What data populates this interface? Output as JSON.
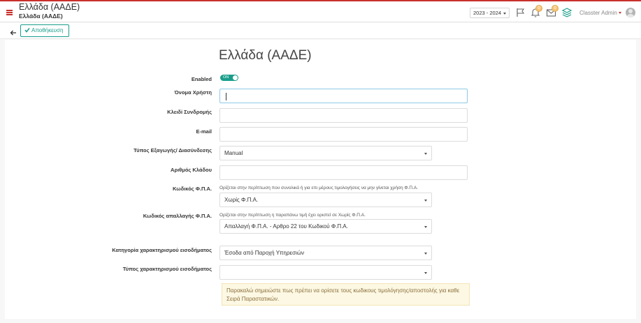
{
  "header": {
    "title": "Ελλάδα (ΑΑΔΕ)",
    "subtitle": "Ελλάδα (ΑΑΔΕ)",
    "year_select": "2023 - 2024",
    "alerts_count": "0",
    "messages_count": "0",
    "user_name": "Classter Admin"
  },
  "toolbar": {
    "save_label": "Αποθήκευση"
  },
  "form": {
    "title": "Ελλάδα (ΑΑΔΕ)",
    "enabled": {
      "label": "Enabled",
      "toggle_text": "ON",
      "value": true
    },
    "username": {
      "label": "Όνομα Χρήστη",
      "value": ""
    },
    "subscription_key": {
      "label": "Κλειδί Συνδρομής",
      "value": ""
    },
    "email": {
      "label": "E-mail",
      "value": ""
    },
    "export_type": {
      "label": "Τύπος Εξαγωγής/ Διασύνδεσης",
      "value": "Manual"
    },
    "branch_number": {
      "label": "Αριθμός Κλάδου",
      "value": ""
    },
    "vat_code": {
      "label": "Κωδικός Φ.Π.Α.",
      "help": "Ορίζεται στην περίπτωση που συνολικά ή για επι μέρους τιμολογήσεις να μην γίνεται χρήση Φ.Π.Α.",
      "value": "Χωρίς Φ.Π.Α."
    },
    "vat_exemption_code": {
      "label": "Κωδικός απαλλαγής Φ.Π.Α.",
      "help": "Ορίζεται στην περίπτωση η παραπάνω τιμή έχει οριστεί σε Χωρίς Φ.Π.Α.",
      "value": "Απαλλαγή Φ.Π.Α. - Αρθρο 22 του Κωδικού Φ.Π.Α."
    },
    "income_category": {
      "label": "Κατηγορία χαρακτηρισμού εισοδήματος",
      "value": "Έσοδα από Παροχή Υπηρεσιών"
    },
    "income_type": {
      "label": "Τύπος χαρακτηρισμού εισοδήματος",
      "value": ""
    },
    "notice": "Παρακαλώ σημειώστε πως πρέπει να ορίσετε τους κωδικους τιμολόγησης/αποστολής για καθε Σειρά Παραστατικών."
  },
  "colors": {
    "accent": "#1a9e8b",
    "brand_red": "#c9302c",
    "notice_bg": "#fcf8e3",
    "notice_text": "#8a6d3b",
    "badge": "#f3c57a"
  },
  "icons": {
    "menu": "hamburger-icon",
    "flag": "flag-icon",
    "bell": "bell-icon",
    "envelope": "envelope-icon",
    "layers": "layers-icon",
    "back": "arrow-left-icon",
    "check": "check-icon"
  }
}
